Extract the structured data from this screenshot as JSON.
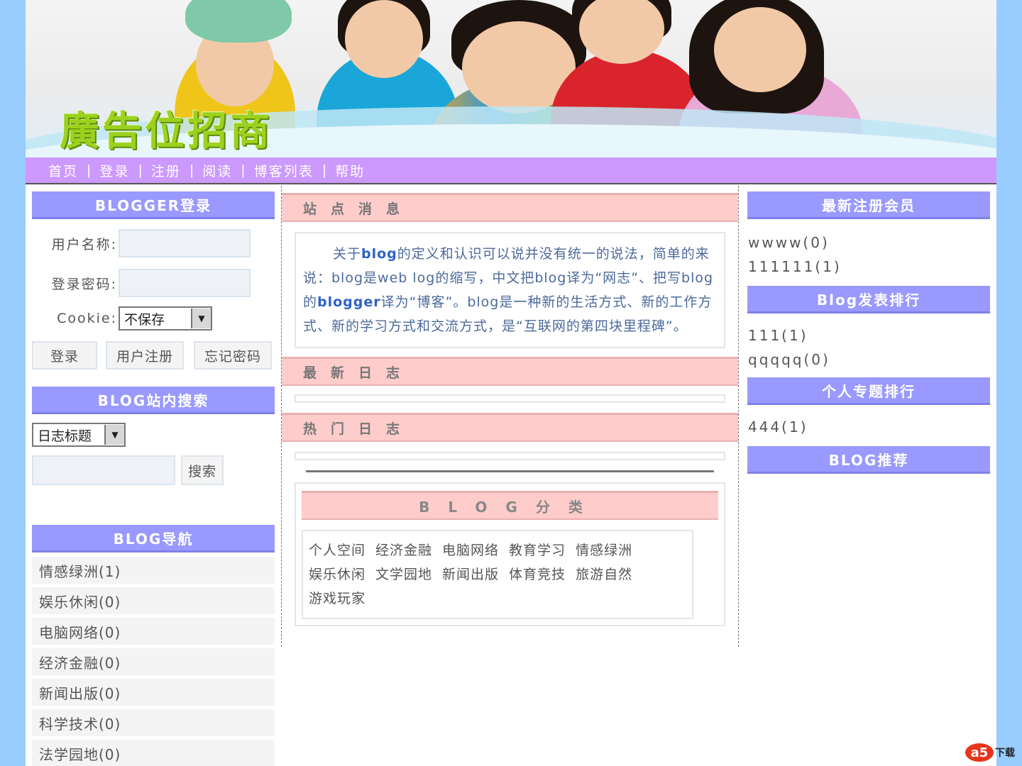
{
  "banner": {
    "ad_text": "廣告位招商"
  },
  "nav": [
    "首页",
    "登录",
    "注册",
    "阅读",
    "博客列表",
    "帮助"
  ],
  "nav_separator": "|",
  "login": {
    "title": "BLOGGER登录",
    "username_label": "用户名称:",
    "password_label": "登录密码:",
    "cookie_label": "Cookie:",
    "cookie_value": "不保存",
    "login_button": "登录",
    "register_button": "用户注册",
    "forgot_button": "忘记密码"
  },
  "search": {
    "title": "BLOG站内搜索",
    "type_value": "日志标题",
    "search_button": "搜索"
  },
  "blog_nav": {
    "title": "BLOG导航",
    "items": [
      "情感绿洲(1)",
      "娱乐休闲(0)",
      "电脑网络(0)",
      "经济金融(0)",
      "新闻出版(0)",
      "科学技术(0)",
      "法学园地(0)"
    ]
  },
  "center": {
    "news_title": "站点消息",
    "intro": {
      "p1": "关于",
      "b1": "blog",
      "p2": "的定义和认识可以说并没有统一的说法，简单的来说：blog是web log的缩写，中文把blog译为“网志”、把写blog的",
      "b2": "blogger",
      "p3": "译为“博客”。blog是一种新的生活方式、新的工作方式、新的学习方式和交流方式，是“互联网的第四块里程碑”。"
    },
    "latest_title": "最新日志",
    "hot_title": "热门日志",
    "category_title": "BLOG分类",
    "categories": [
      "个人空间",
      "经济金融",
      "电脑网络",
      "教育学习",
      "情感绿洲",
      "娱乐休闲",
      "文学园地",
      "新闻出版",
      "体育竞技",
      "旅游自然",
      "游戏玩家"
    ]
  },
  "right": {
    "members_title": "最新注册会员",
    "members": [
      "wwww(0)",
      "111111(1)"
    ],
    "ranking_title": "Blog发表排行",
    "ranking": [
      "111(1)",
      "qqqqq(0)"
    ],
    "topics_title": "个人专题排行",
    "topics": [
      "444(1)"
    ],
    "recommend_title": "BLOG推荐"
  },
  "watermark": {
    "logo": "a5",
    "text": "下载"
  }
}
